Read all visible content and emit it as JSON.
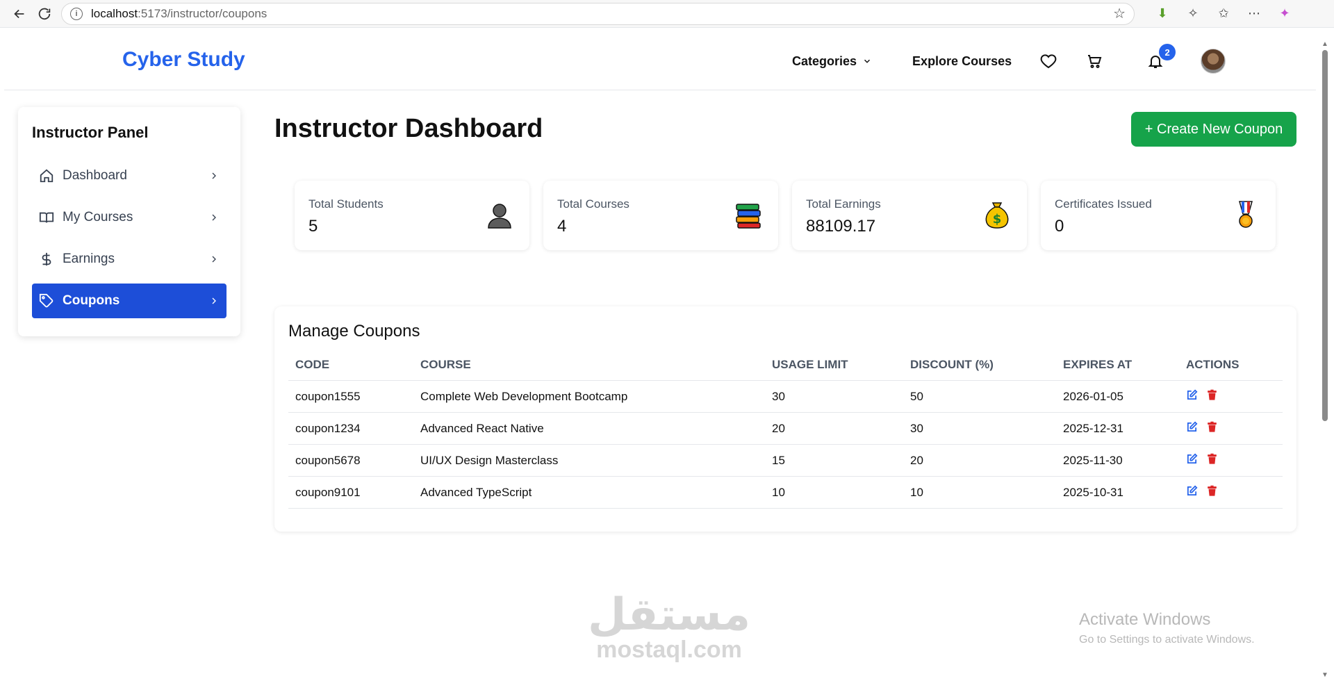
{
  "browser": {
    "url_host": "localhost",
    "url_path": ":5173/instructor/coupons"
  },
  "header": {
    "logo": "Cyber Study",
    "nav": {
      "categories": "Categories",
      "explore": "Explore Courses"
    },
    "notification_count": "2"
  },
  "sidebar": {
    "title": "Instructor Panel",
    "items": [
      {
        "label": "Dashboard",
        "icon": "home-icon"
      },
      {
        "label": "My Courses",
        "icon": "book-icon"
      },
      {
        "label": "Earnings",
        "icon": "dollar-icon"
      },
      {
        "label": "Coupons",
        "icon": "tag-icon",
        "active": true
      }
    ]
  },
  "main": {
    "title": "Instructor Dashboard",
    "create_button": "+ Create New Coupon",
    "stats": [
      {
        "label": "Total Students",
        "value": "5",
        "icon": "person-icon"
      },
      {
        "label": "Total Courses",
        "value": "4",
        "icon": "books-icon"
      },
      {
        "label": "Total Earnings",
        "value": "88109.17",
        "icon": "money-bag-icon"
      },
      {
        "label": "Certificates Issued",
        "value": "0",
        "icon": "medal-icon"
      }
    ]
  },
  "coupons": {
    "title": "Manage Coupons",
    "columns": [
      "CODE",
      "COURSE",
      "USAGE LIMIT",
      "DISCOUNT (%)",
      "EXPIRES AT",
      "ACTIONS"
    ],
    "rows": [
      {
        "code": "coupon1555",
        "course": "Complete Web Development Bootcamp",
        "usage_limit": "30",
        "discount": "50",
        "expires": "2026-01-05"
      },
      {
        "code": "coupon1234",
        "course": "Advanced React Native",
        "usage_limit": "20",
        "discount": "30",
        "expires": "2025-12-31"
      },
      {
        "code": "coupon5678",
        "course": "UI/UX Design Masterclass",
        "usage_limit": "15",
        "discount": "20",
        "expires": "2025-11-30"
      },
      {
        "code": "coupon9101",
        "course": "Advanced TypeScript",
        "usage_limit": "10",
        "discount": "10",
        "expires": "2025-10-31"
      }
    ]
  },
  "watermark": {
    "arabic": "مستقل",
    "latin": "mostaql.com"
  },
  "os_overlay": {
    "line1": "Activate Windows",
    "line2": "Go to Settings to activate Windows."
  },
  "colors": {
    "brand": "#2563eb",
    "active_nav": "#1d4ed8",
    "create_button": "#16a34a",
    "edit_icon": "#2563eb",
    "delete_icon": "#dc2626"
  }
}
